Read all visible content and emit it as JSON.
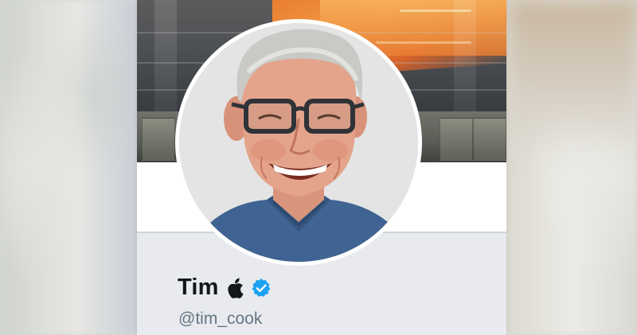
{
  "profile": {
    "display_name": "Tim",
    "handle": "@tim_cook",
    "name_icons": [
      "apple-logo-icon",
      "verified-badge-icon"
    ]
  },
  "colors": {
    "name_text": "#14171a",
    "handle_text": "#657786",
    "verified_blue": "#1da1f2",
    "card_background": "#e8eaed",
    "header_white": "#ffffff"
  }
}
